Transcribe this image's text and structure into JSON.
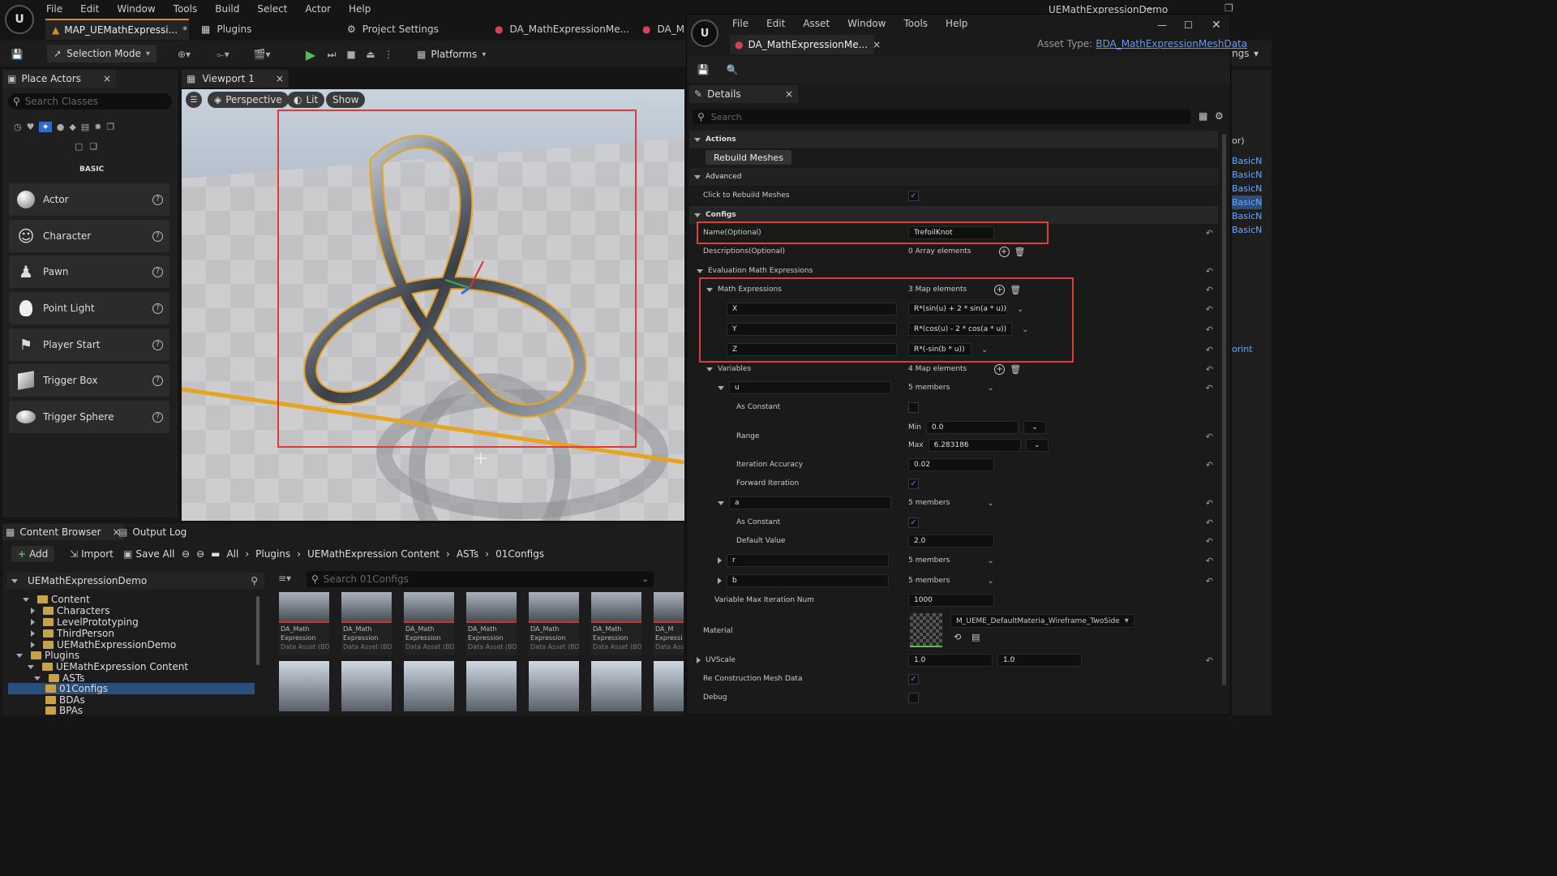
{
  "main_window": {
    "title": "UEMathExpressionDemo",
    "menu": [
      "File",
      "Edit",
      "Window",
      "Tools",
      "Build",
      "Select",
      "Actor",
      "Help"
    ],
    "tabs": {
      "map": "MAP_UEMathExpressi...",
      "map_modified": "*",
      "plugins": "Plugins",
      "project_settings": "Project Settings",
      "asset1": "DA_MathExpressionMe...",
      "asset2": "DA_M"
    },
    "toolbar": {
      "selection_mode": "Selection Mode",
      "platforms": "Platforms"
    },
    "right_edge_text": "ngs"
  },
  "place_actors": {
    "tab": "Place Actors",
    "search_placeholder": "Search Classes",
    "category": "BASIC",
    "items": [
      "Actor",
      "Character",
      "Pawn",
      "Point Light",
      "Player Start",
      "Trigger Box",
      "Trigger Sphere"
    ]
  },
  "viewport": {
    "tab": "Viewport 1",
    "perspective": "Perspective",
    "lit": "Lit",
    "show": "Show"
  },
  "content_browser": {
    "tabs": {
      "content_browser": "Content Browser",
      "output_log": "Output Log"
    },
    "toolbar": {
      "add": "Add",
      "import": "Import",
      "save_all": "Save All"
    },
    "breadcrumb": [
      "All",
      "Plugins",
      "UEMathExpression Content",
      "ASTs",
      "01Configs"
    ],
    "tree_root": "UEMathExpressionDemo",
    "tree": [
      {
        "label": "Content",
        "depth": 1
      },
      {
        "label": "Characters",
        "depth": 2
      },
      {
        "label": "LevelPrototyping",
        "depth": 2
      },
      {
        "label": "ThirdPerson",
        "depth": 2
      },
      {
        "label": "UEMathExpressionDemo",
        "depth": 2
      },
      {
        "label": "Plugins",
        "depth": 1
      },
      {
        "label": "UEMathExpression Content",
        "depth": 2
      },
      {
        "label": "ASTs",
        "depth": 3
      },
      {
        "label": "01Configs",
        "depth": 4,
        "selected": true
      },
      {
        "label": "BDAs",
        "depth": 4
      },
      {
        "label": "BPAs",
        "depth": 4
      }
    ],
    "search_placeholder": "Search 01Configs",
    "asset_line1": "DA_Math",
    "asset_line2": "Expression",
    "asset_line3": "Data Asset (BD...",
    "asset_line3_cut": "Data Asse",
    "asset_line2_cut": "Expressi",
    "asset_line1_cut": "DA_M"
  },
  "asset_editor": {
    "menu": [
      "File",
      "Edit",
      "Asset",
      "Window",
      "Tools",
      "Help"
    ],
    "tab": "DA_MathExpressionMe...",
    "asset_type_label": "Asset Type:",
    "asset_type_value": "BDA_MathExpressionMeshData",
    "details_tab": "Details",
    "search_placeholder": "Search",
    "actions": {
      "category": "Actions",
      "button": "Rebuild Meshes"
    },
    "advanced": {
      "category": "Advanced",
      "click_to_rebuild": "Click to Rebuild Meshes"
    },
    "configs": {
      "category": "Configs",
      "name_label": "Name(Optional)",
      "name_value": "TrefoilKnot",
      "descriptions_label": "Descriptions(Optional)",
      "descriptions_value": "0 Array elements",
      "eval_label": "Evaluation Math Expressions",
      "math_expr_label": "Math Expressions",
      "math_expr_count": "3 Map elements",
      "expressions": [
        {
          "key": "X",
          "value": "R*(sin(u) + 2 * sin(a * u))"
        },
        {
          "key": "Y",
          "value": "R*(cos(u) - 2 * cos(a * u))"
        },
        {
          "key": "Z",
          "value": "R*(-sin(b * u))"
        }
      ],
      "variables_label": "Variables",
      "variables_count": "4 Map elements",
      "var_u": {
        "key": "u",
        "members": "5 members",
        "as_constant": "As Constant",
        "range": "Range",
        "min_label": "Min",
        "min": "0.0",
        "max_label": "Max",
        "max": "6.283186",
        "iteration_accuracy": "Iteration Accuracy",
        "iteration_value": "0.02",
        "forward_iteration": "Forward Iteration"
      },
      "var_a": {
        "key": "a",
        "members": "5 members",
        "as_constant": "As Constant",
        "default_value": "Default Value",
        "default": "2.0"
      },
      "var_r": {
        "key": "r",
        "members": "5 members"
      },
      "var_b": {
        "key": "b",
        "members": "5 members"
      },
      "max_iter_label": "Variable Max Iteration Num",
      "max_iter_value": "1000",
      "material_label": "Material",
      "material_value": "M_UEME_DefaultMateria_Wireframe_TwoSide",
      "uvscale_label": "UVScale",
      "uvscale_x": "1.0",
      "uvscale_y": "1.0",
      "reconstruction_label": "Re Construction Mesh Data",
      "debug_label": "Debug"
    }
  },
  "background_panel_items": [
    "or)",
    "BasicN",
    "BasicN",
    "BasicN",
    "BasicN",
    "BasicN",
    "BasicN",
    "orint"
  ]
}
